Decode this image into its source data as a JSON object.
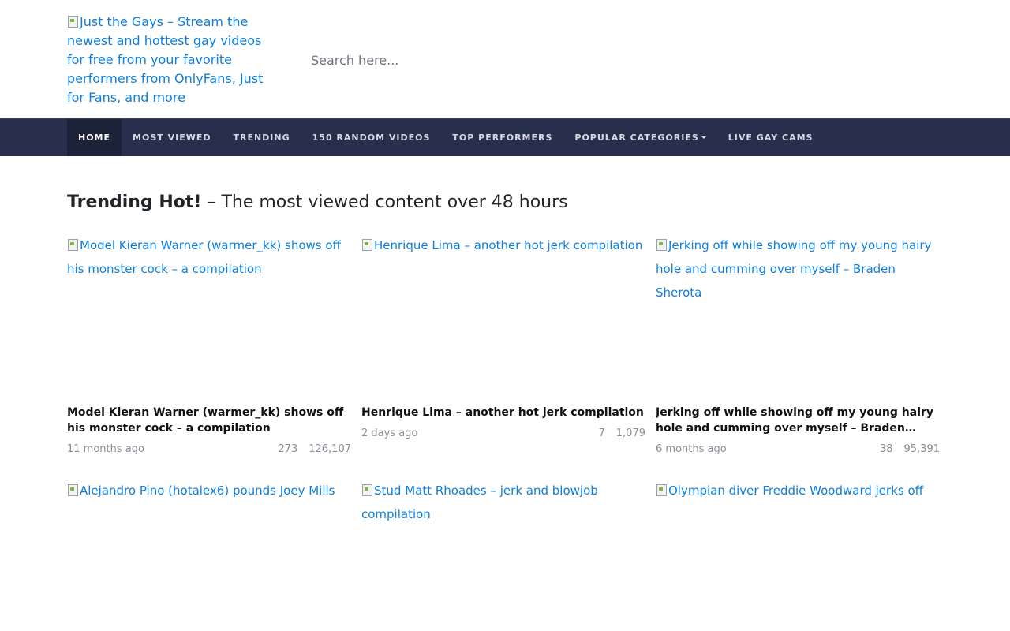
{
  "header": {
    "logo_alt": "Just the Gays – Stream the newest and hottest gay videos for free from your favorite performers from OnlyFans, Just for Fans, and more",
    "search_placeholder": "Search here..."
  },
  "nav": {
    "items": [
      {
        "label": "HOME"
      },
      {
        "label": "MOST VIEWED"
      },
      {
        "label": "TRENDING"
      },
      {
        "label": "150 RANDOM VIDEOS"
      },
      {
        "label": "TOP PERFORMERS"
      },
      {
        "label": "POPULAR CATEGORIES"
      },
      {
        "label": "LIVE GAY CAMS"
      }
    ]
  },
  "main": {
    "heading_bold": "Trending Hot!",
    "heading_rest": " – The most viewed content over 48 hours",
    "videos": [
      {
        "thumb_alt": "Model Kieran Warner (warmer_kk) shows off his monster cock – a compilation",
        "title": "Model Kieran Warner (warmer_kk) shows off his monster cock – a compilation",
        "date": "11 months ago",
        "likes": "273",
        "views": "126,107"
      },
      {
        "thumb_alt": "Henrique Lima – another hot jerk compilation",
        "title": "Henrique Lima – another hot jerk compilation",
        "date": "2 days ago",
        "likes": "7",
        "views": "1,079"
      },
      {
        "thumb_alt": "Jerking off while showing off my young hairy hole and cumming over myself – Braden Sherota",
        "title": "Jerking off while showing off my young hairy hole and cumming over myself – Braden Sherota",
        "date": "6 months ago",
        "likes": "38",
        "views": "95,391"
      },
      {
        "thumb_alt": "Alejandro Pino (hotalex6) pounds Joey Mills"
      },
      {
        "thumb_alt": "Stud Matt Rhoades – jerk and blowjob compilation"
      },
      {
        "thumb_alt": "Olympian diver Freddie Woodward jerks off"
      }
    ]
  }
}
